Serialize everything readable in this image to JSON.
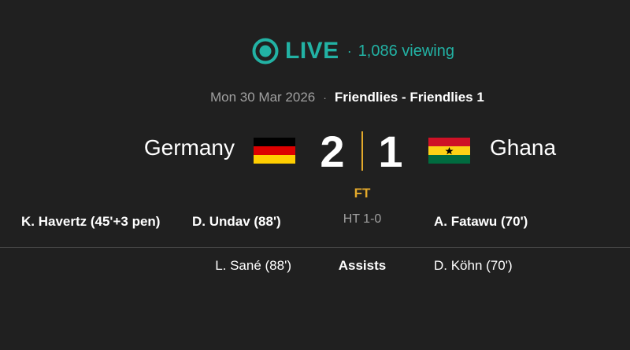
{
  "live": {
    "label": "LIVE",
    "separator": "·",
    "viewing": "1,086 viewing",
    "icon": "live-broadcast-icon",
    "color": "#22b2a4"
  },
  "meta": {
    "date": "Mon 30 Mar 2026",
    "separator": "·",
    "competition": "Friendlies - Friendlies 1"
  },
  "match": {
    "home": {
      "name": "Germany",
      "score": "2",
      "flag_colors": [
        "#000000",
        "#dd0000",
        "#ffce00"
      ]
    },
    "away": {
      "name": "Ghana",
      "score": "1",
      "flag_colors": [
        "#ce1126",
        "#fcd116",
        "#006b3f"
      ],
      "flag_star_color": "#000000"
    },
    "status": "FT",
    "halftime": "HT 1-0",
    "accent_color": "#e3a92b"
  },
  "scorers": {
    "home": [
      "K. Havertz (45'+3 pen)",
      "D. Undav (88')"
    ],
    "away": [
      "A. Fatawu (70')"
    ]
  },
  "assists": {
    "label": "Assists",
    "home": "L. Sané (88')",
    "away": "D. Köhn (70')"
  }
}
